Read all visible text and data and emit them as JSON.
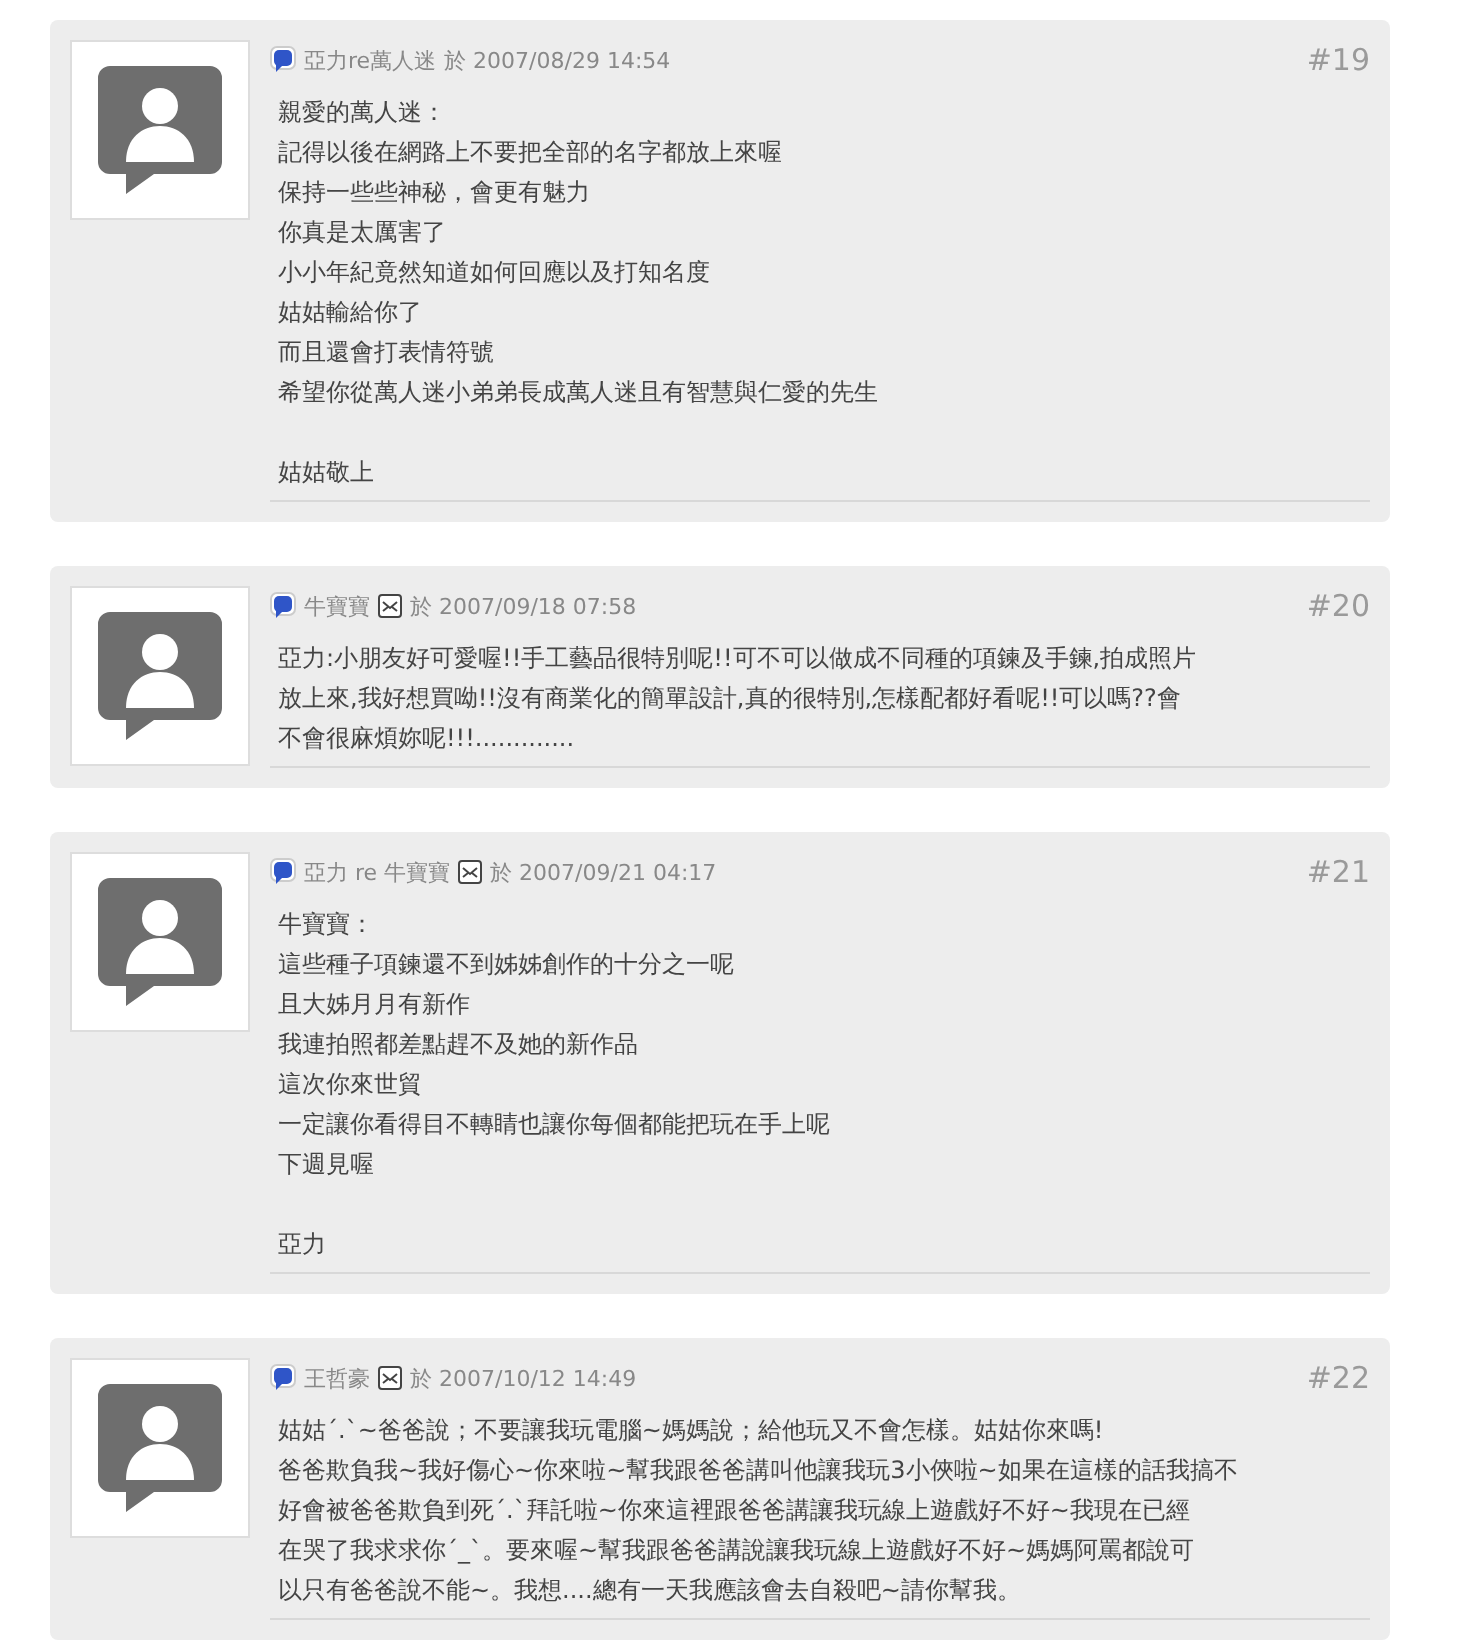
{
  "posts": [
    {
      "author": "亞力re萬人迷",
      "mail": false,
      "posted": "於 2007/08/29 14:54",
      "number": "#19",
      "paragraphs": [
        [
          "親愛的萬人迷：",
          "記得以後在網路上不要把全部的名字都放上來喔",
          "保持一些些神秘，會更有魅力",
          "你真是太厲害了",
          "小小年紀竟然知道如何回應以及打知名度",
          "姑姑輸給你了",
          "而且還會打表情符號",
          "希望你從萬人迷小弟弟長成萬人迷且有智慧與仁愛的先生"
        ],
        [
          "姑姑敬上"
        ]
      ]
    },
    {
      "author": "牛寶寶",
      "mail": true,
      "posted": "於 2007/09/18 07:58",
      "number": "#20",
      "paragraphs": [
        [
          "亞力:小朋友好可愛喔!!手工藝品很特別呢!!可不可以做成不同種的項鍊及手鍊,拍成照片",
          "放上來,我好想買呦!!沒有商業化的簡單設計,真的很特別,怎樣配都好看呢!!可以嗎??會",
          "不會很麻煩妳呢!!!............."
        ]
      ]
    },
    {
      "author": "亞力 re 牛寶寶",
      "mail": true,
      "posted": "於 2007/09/21 04:17",
      "number": "#21",
      "paragraphs": [
        [
          "牛寶寶：",
          "這些種子項鍊還不到姊姊創作的十分之一呢",
          "且大姊月月有新作",
          "我連拍照都差點趕不及她的新作品",
          "這次你來世貿",
          "一定讓你看得目不轉睛也讓你每個都能把玩在手上呢",
          "下週見喔"
        ],
        [
          "亞力"
        ]
      ]
    },
    {
      "author": "王哲豪",
      "mail": true,
      "posted": "於 2007/10/12 14:49",
      "number": "#22",
      "paragraphs": [
        [
          "姑姑´.`~爸爸說；不要讓我玩電腦~媽媽說；給他玩又不會怎樣。姑姑你來嗎!",
          "爸爸欺負我~我好傷心~你來啦~幫我跟爸爸講叫他讓我玩3小俠啦~如果在這樣的話我搞不",
          "好會被爸爸欺負到死´.`拜託啦~你來這裡跟爸爸講讓我玩線上遊戲好不好~我現在已經",
          "在哭了我求求你´_`。要來喔~幫我跟爸爸講說讓我玩線上遊戲好不好~媽媽阿罵都說可",
          "以只有爸爸說不能~。我想....總有一天我應該會去自殺吧~請你幫我。"
        ]
      ]
    }
  ]
}
